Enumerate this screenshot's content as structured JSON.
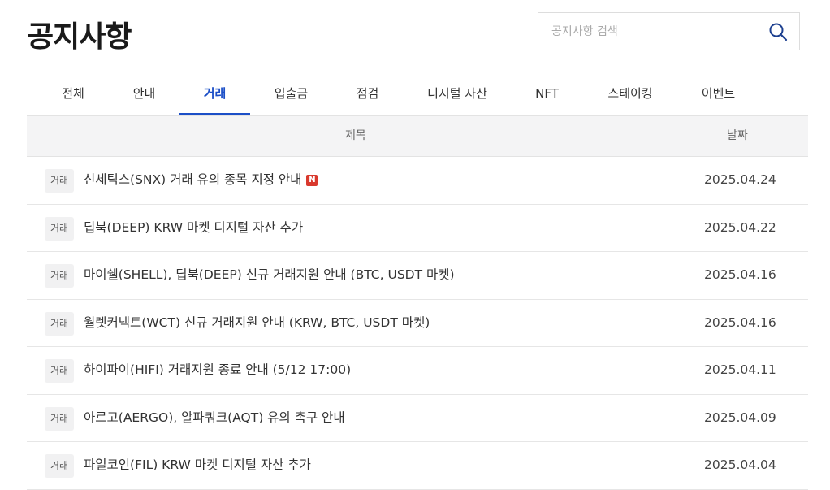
{
  "page_title": "공지사항",
  "search": {
    "placeholder": "공지사항 검색"
  },
  "tabs": [
    {
      "label": "전체",
      "active": false
    },
    {
      "label": "안내",
      "active": false
    },
    {
      "label": "거래",
      "active": true
    },
    {
      "label": "입출금",
      "active": false
    },
    {
      "label": "점검",
      "active": false
    },
    {
      "label": "디지털 자산",
      "active": false
    },
    {
      "label": "NFT",
      "active": false
    },
    {
      "label": "스테이킹",
      "active": false
    },
    {
      "label": "이벤트",
      "active": false
    }
  ],
  "table": {
    "headers": {
      "title": "제목",
      "date": "날짜"
    },
    "rows": [
      {
        "category": "거래",
        "title": "신세틱스(SNX) 거래 유의 종목 지정 안내",
        "is_new": true,
        "new_label": "N",
        "date": "2025.04.24"
      },
      {
        "category": "거래",
        "title": "딥북(DEEP) KRW 마켓 디지털 자산 추가",
        "is_new": false,
        "date": "2025.04.22"
      },
      {
        "category": "거래",
        "title": "마이쉘(SHELL), 딥북(DEEP) 신규 거래지원 안내 (BTC, USDT 마켓)",
        "is_new": false,
        "date": "2025.04.16"
      },
      {
        "category": "거래",
        "title": "월렛커넥트(WCT) 신규 거래지원 안내 (KRW, BTC, USDT 마켓)",
        "is_new": false,
        "date": "2025.04.16"
      },
      {
        "category": "거래",
        "title": "하이파이(HIFI) 거래지원 종료 안내 (5/12 17:00)",
        "is_new": false,
        "hovered": true,
        "date": "2025.04.11"
      },
      {
        "category": "거래",
        "title": "아르고(AERGO), 알파쿼크(AQT) 유의 촉구 안내",
        "is_new": false,
        "date": "2025.04.09"
      },
      {
        "category": "거래",
        "title": "파일코인(FIL) KRW 마켓 디지털 자산 추가",
        "is_new": false,
        "date": "2025.04.04"
      }
    ]
  },
  "colors": {
    "accent": "#1c4fc7",
    "new_badge": "#d9392d"
  }
}
